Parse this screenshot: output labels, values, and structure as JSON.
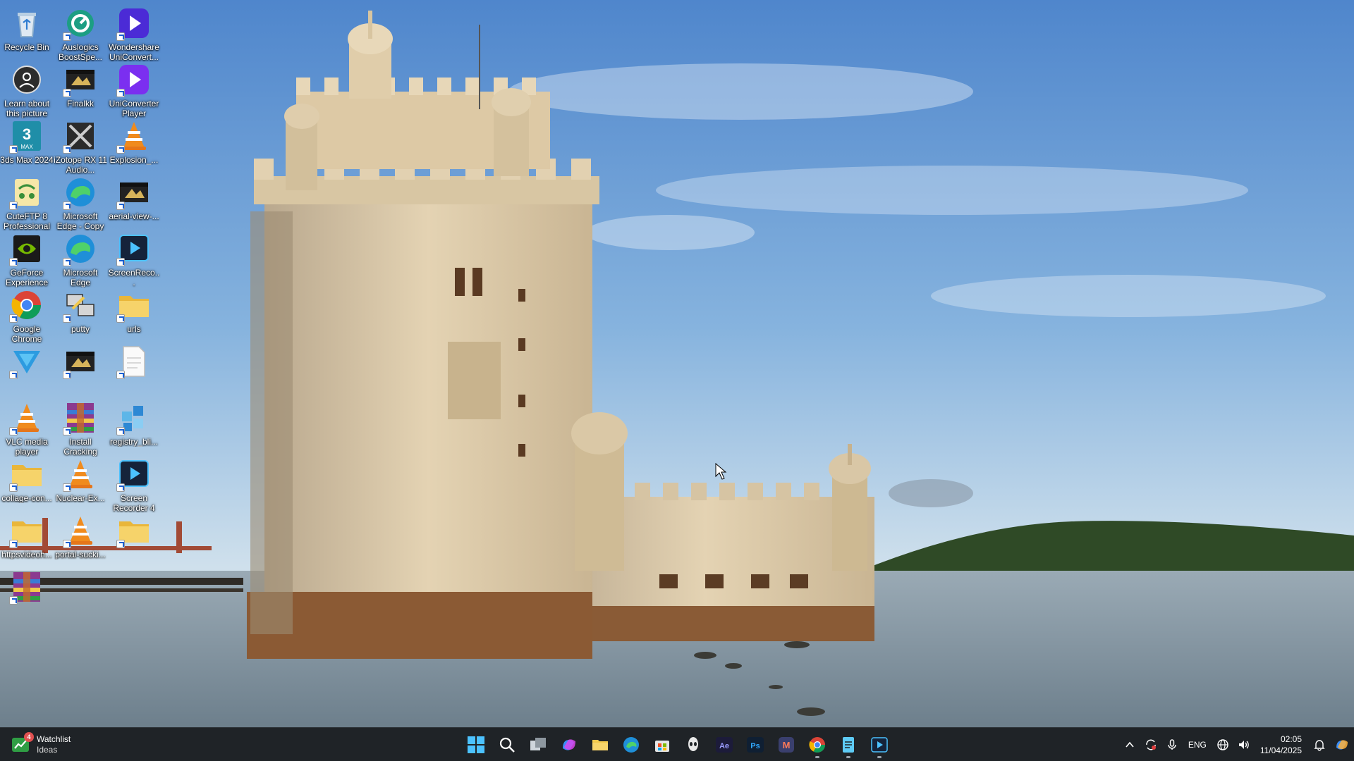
{
  "desktop": {
    "icons": [
      {
        "label": "Recycle Bin",
        "icon": "recycle-bin-icon"
      },
      {
        "label": "Auslogics BoostSpe...",
        "icon": "auslogics-icon"
      },
      {
        "label": "Wondershare UniConvert...",
        "icon": "wondershare-icon"
      },
      {
        "label": "Learn about this picture",
        "icon": "camera-icon"
      },
      {
        "label": "Finalkk",
        "icon": "video-file-icon"
      },
      {
        "label": "UniConverter Player",
        "icon": "uniconverter-player-icon"
      },
      {
        "label": "3ds Max 2024",
        "icon": "3ds-max-icon"
      },
      {
        "label": "iZotope RX 11 Audio...",
        "icon": "izotope-icon"
      },
      {
        "label": "Explosion_...",
        "icon": "vlc-icon"
      },
      {
        "label": "CuteFTP 8 Professional",
        "icon": "cuteftp-icon"
      },
      {
        "label": "Microsoft Edge - Copy",
        "icon": "edge-icon"
      },
      {
        "label": "aerial-view-...",
        "icon": "video-file-icon"
      },
      {
        "label": "GeForce Experience",
        "icon": "geforce-icon"
      },
      {
        "label": "Microsoft Edge",
        "icon": "edge-icon"
      },
      {
        "label": "ScreenReco...",
        "icon": "screen-recorder-icon"
      },
      {
        "label": "Google Chrome",
        "icon": "chrome-icon"
      },
      {
        "label": "putty",
        "icon": "putty-icon"
      },
      {
        "label": "urls",
        "icon": "folder-icon"
      },
      {
        "label": "",
        "icon": "triangle-app-icon"
      },
      {
        "label": "",
        "icon": "video-file-icon"
      },
      {
        "label": "",
        "icon": "text-file-icon"
      },
      {
        "label": "VLC media player",
        "icon": "vlc-icon"
      },
      {
        "label": "Install Cracking",
        "icon": "winrar-icon"
      },
      {
        "label": "registry_bli...",
        "icon": "registry-file-icon"
      },
      {
        "label": "collage-con...",
        "icon": "folder-icon"
      },
      {
        "label": "Nuclear-Ex...",
        "icon": "vlc-icon"
      },
      {
        "label": "Screen Recorder 4",
        "icon": "screen-recorder-icon"
      },
      {
        "label": "httpsvideoh...",
        "icon": "folder-icon"
      },
      {
        "label": "portal-sucki...",
        "icon": "vlc-icon"
      },
      {
        "label": "",
        "icon": "folder-icon"
      },
      {
        "label": "",
        "icon": "winrar-icon"
      }
    ]
  },
  "taskbar": {
    "widget": {
      "badge": "4",
      "title": "Watchlist",
      "subtitle": "Ideas",
      "icon": "stock-chart-icon"
    },
    "apps": [
      {
        "name": "start-button",
        "icon": "windows-logo-icon",
        "running": false
      },
      {
        "name": "search-button",
        "icon": "search-icon",
        "running": false
      },
      {
        "name": "task-view-button",
        "icon": "task-view-icon",
        "running": false
      },
      {
        "name": "copilot-button",
        "icon": "copilot-icon",
        "running": false
      },
      {
        "name": "file-explorer-button",
        "icon": "folder-icon",
        "running": false
      },
      {
        "name": "edge-button",
        "icon": "edge-icon",
        "running": false
      },
      {
        "name": "store-button",
        "icon": "store-icon",
        "running": false
      },
      {
        "name": "alienware-button",
        "icon": "alien-icon",
        "running": false
      },
      {
        "name": "after-effects-button",
        "icon": "after-effects-icon",
        "label": "Ae",
        "running": false
      },
      {
        "name": "photoshop-button",
        "icon": "photoshop-icon",
        "label": "Ps",
        "running": false
      },
      {
        "name": "malwarebytes-button",
        "icon": "malwarebytes-icon",
        "label": "M",
        "running": false
      },
      {
        "name": "chrome-button",
        "icon": "chrome-icon",
        "running": true
      },
      {
        "name": "notepad-button",
        "icon": "notepad-icon",
        "running": true
      },
      {
        "name": "screen-recorder-button",
        "icon": "screen-recorder-icon",
        "running": true
      }
    ],
    "tray": {
      "language": "ENG",
      "time": "02:05",
      "date": "11/04/2025"
    }
  },
  "colors": {
    "taskbar_bg": "#1f2327",
    "sky_top": "#5f8fcf",
    "sky_bottom": "#cfe0ec",
    "water": "#7c8f9c"
  }
}
